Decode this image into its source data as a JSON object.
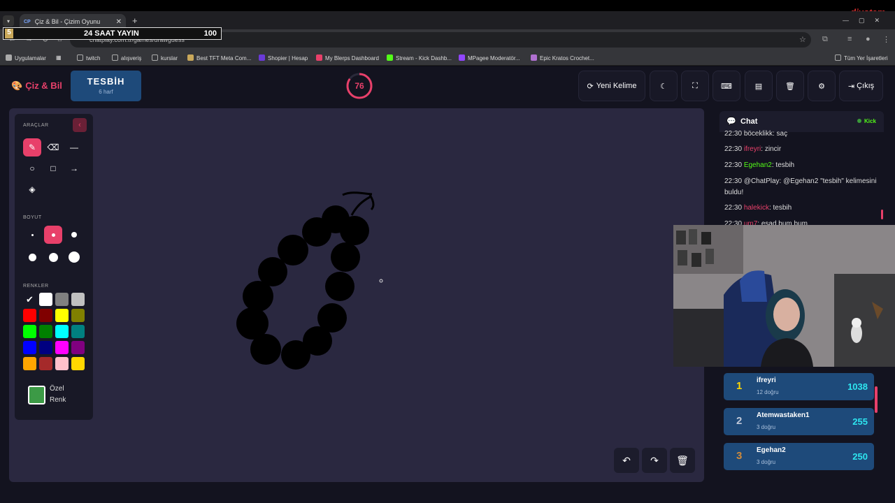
{
  "browser": {
    "tab_title": "Çiz & Bil - Çizim Oyunu",
    "tab_favicon": "CP",
    "url": "chatplay.com.tr/games/drawguess",
    "bookmarks": [
      "Uygulamalar",
      "twitch",
      "alışveriş",
      "kurslar",
      "Best TFT Meta Com...",
      "Shopier | Hesap",
      "My Blerps Dashboard",
      "Stream - Kick Dashb...",
      "MPagee Moderatör...",
      "Epic Kratos Crochet...",
      "Tüm Yer İşaretleri"
    ],
    "watermark": "diyotam"
  },
  "overlay": {
    "count": "5",
    "label": "24 SAAT YAYIN",
    "goal": "100"
  },
  "app": {
    "logo": "Çiz & Bil",
    "word": "TESBİH",
    "word_hint": "6 harf",
    "timer": "76",
    "timer_fraction": 0.85,
    "buttons": {
      "new_word": "Yeni Kelime",
      "exit": "Çıkış"
    }
  },
  "tools": {
    "title": "ARAÇLAR",
    "size_title": "BOYUT",
    "colors_title": "RENKLER",
    "custom_label_1": "Özel",
    "custom_label_2": "Renk",
    "palette": [
      "#000000",
      "#ffffff",
      "#808080",
      "#c0c0c0",
      "#ff0000",
      "#800000",
      "#ffff00",
      "#808000",
      "#00ff00",
      "#008000",
      "#00ffff",
      "#008080",
      "#0000ff",
      "#000080",
      "#ff00ff",
      "#800080",
      "#ffa500",
      "#a52a2a",
      "#ffc0cb",
      "#ffd700"
    ],
    "accent": "#e8406a"
  },
  "chat": {
    "title": "Chat",
    "platform": "Kick",
    "messages": [
      {
        "time": "22:30",
        "user": "böceklikk",
        "color": "#dddddd",
        "text": ": saç"
      },
      {
        "time": "22:30",
        "user": "ifreyri",
        "color": "#e8406a",
        "text": ": zincir"
      },
      {
        "time": "22:30",
        "user": "Egehan2",
        "color": "#53fc18",
        "text": ": tesbih"
      },
      {
        "time": "22:30",
        "user": "@ChatPlay",
        "color": "#dddddd",
        "text": ": @Egehan2 \"tesbih\" kelimesini buldu!"
      },
      {
        "time": "22:30",
        "user": "halekick",
        "color": "#e8406a",
        "text": ": tesbih"
      },
      {
        "time": "22:30",
        "user": "um7",
        "color": "#e8406a",
        "text": ": esad bum bum"
      }
    ]
  },
  "leaderboard": [
    {
      "rank": "1",
      "name": "ifreyri",
      "sub": "12 doğru",
      "score": "1038",
      "rank_color": "#ffd700"
    },
    {
      "rank": "2",
      "name": "Atemwastaken1",
      "sub": "3 doğru",
      "score": "255",
      "rank_color": "#c0c8d8"
    },
    {
      "rank": "3",
      "name": "Egehan2",
      "sub": "3 doğru",
      "score": "250",
      "rank_color": "#d08a3a"
    }
  ]
}
